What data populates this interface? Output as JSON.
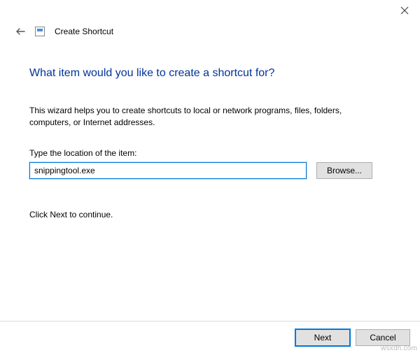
{
  "header": {
    "title": "Create Shortcut"
  },
  "heading": "What item would you like to create a shortcut for?",
  "description": "This wizard helps you to create shortcuts to local or network programs, files, folders, computers, or Internet addresses.",
  "field": {
    "label": "Type the location of the item:",
    "value": "snippingtool.exe"
  },
  "browse_label": "Browse...",
  "continue_text": "Click Next to continue.",
  "footer": {
    "next_label": "Next",
    "cancel_label": "Cancel"
  },
  "watermark": "wsxdn.com"
}
